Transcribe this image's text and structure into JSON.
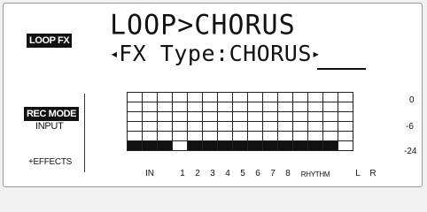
{
  "mode_badge": "LOOP FX",
  "title_text": "LOOP>CHORUS",
  "fx_type_text": "FX Type:",
  "fx_type_value": "CHORUS",
  "arrow_left": "◂",
  "arrow_right": "▸",
  "rec_mode_label": "REC MODE",
  "input_label": "INPUT",
  "effects_label": "+EFFECTS",
  "scale_labels": [
    "0",
    "-6",
    "-24"
  ],
  "channel_labels": [
    "IN",
    "1",
    "2",
    "3",
    "4",
    "5",
    "6",
    "7",
    "8",
    "RHYTHM",
    "L",
    "R"
  ],
  "meter_colors": {
    "on": "#111111",
    "off": "#ffffff"
  }
}
